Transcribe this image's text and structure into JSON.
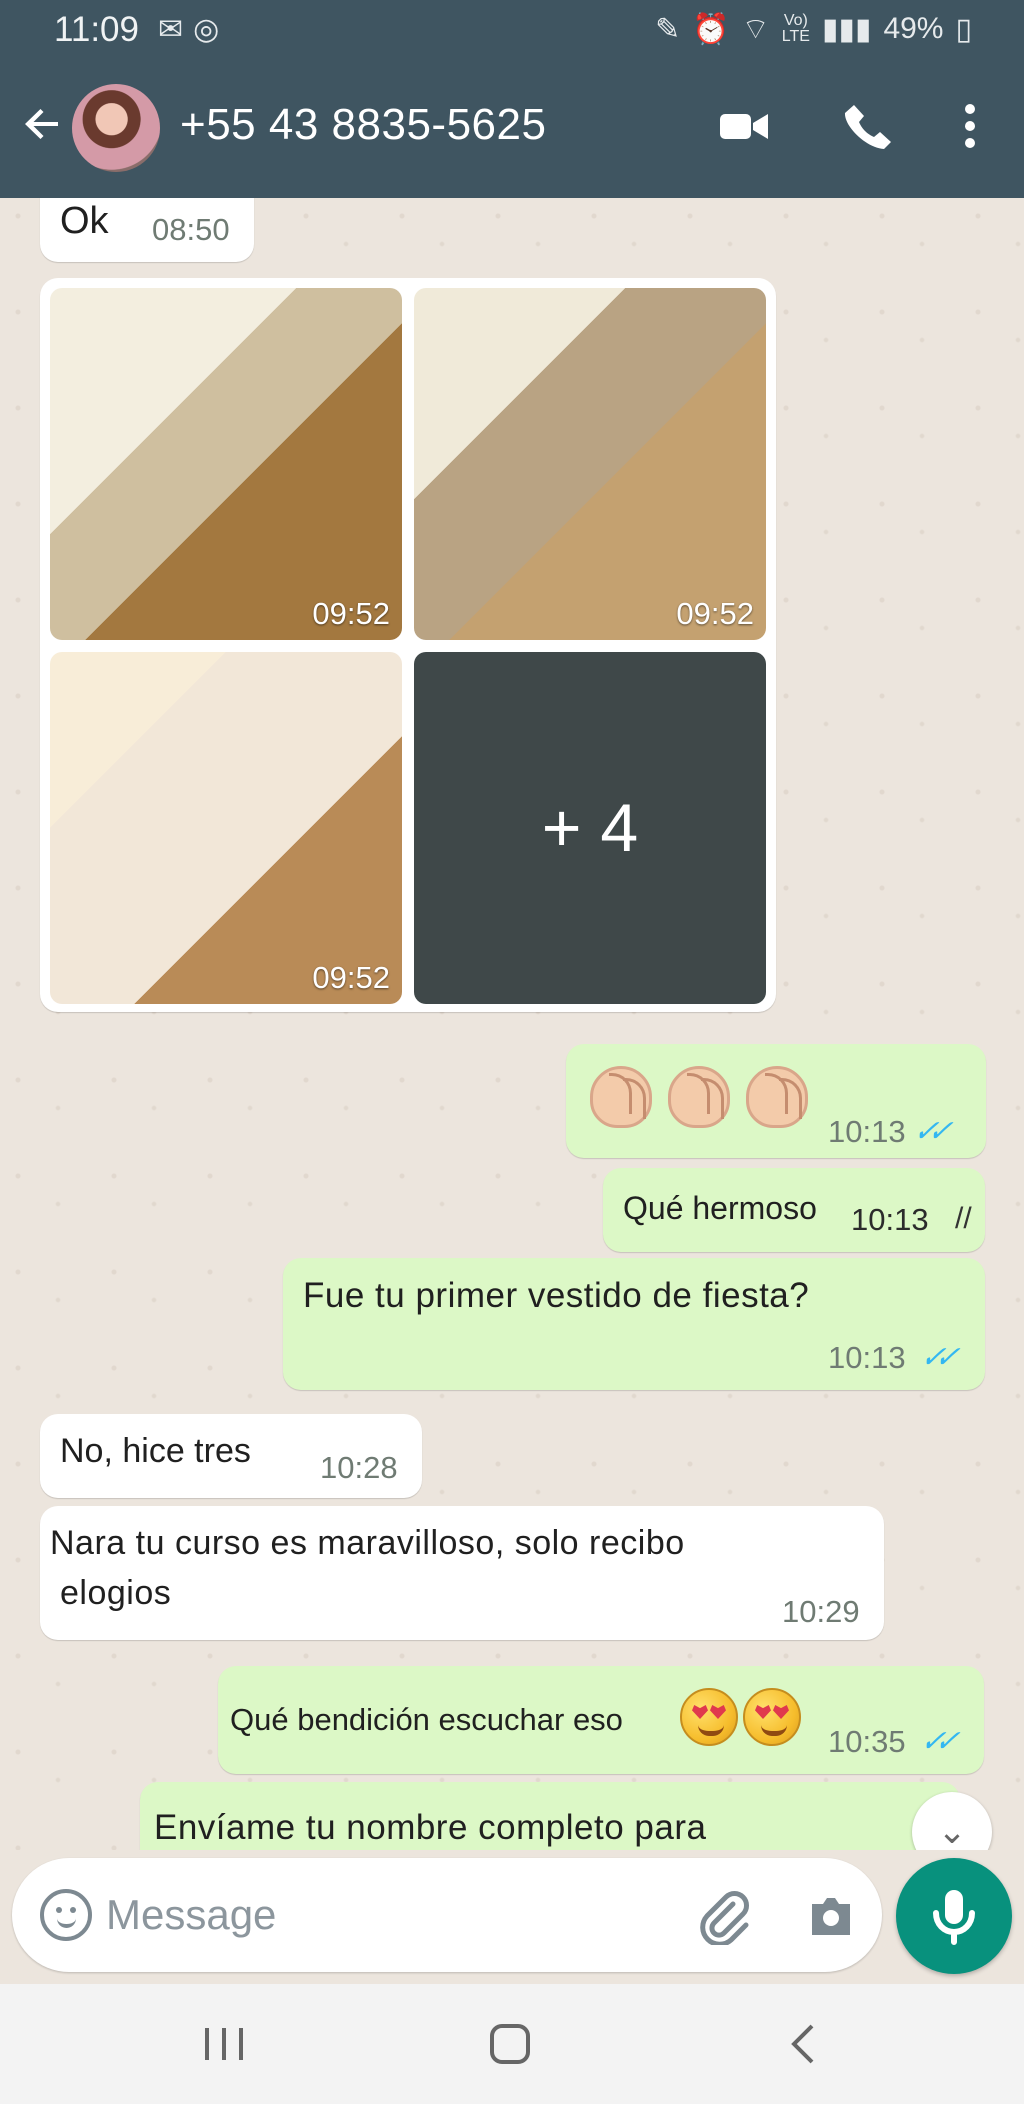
{
  "status_bar": {
    "time": "11:09",
    "battery": "49%"
  },
  "header": {
    "contact": "+55 43 8835-5625",
    "avatar": "contact-avatar"
  },
  "messages": [
    {
      "direction": "incoming",
      "text": "Ok",
      "time": "08:50"
    },
    {
      "direction": "incoming",
      "type": "image-grid",
      "tiles": [
        {
          "time": "09:52"
        },
        {
          "time": "09:52"
        },
        {
          "time": "09:52"
        },
        {
          "more_count": "+ 4"
        }
      ]
    },
    {
      "direction": "outgoing",
      "type": "emoji",
      "time": "10:13"
    },
    {
      "direction": "outgoing",
      "text": "Qué hermoso",
      "time": "10:13"
    },
    {
      "direction": "outgoing",
      "text": "Fue tu primer vestido de fiesta?",
      "time": "10:13"
    },
    {
      "direction": "incoming",
      "text": "No, hice tres",
      "time": "10:28"
    },
    {
      "direction": "incoming",
      "text_line_1": "Nara tu curso es maravilloso, solo recibo",
      "text_line_2": "elogios",
      "time": "10:29"
    },
    {
      "direction": "outgoing",
      "text": "Qué bendición escuchar eso",
      "time": "10:35"
    },
    {
      "direction": "outgoing",
      "text": "Envíame tu nombre completo para"
    }
  ],
  "composer": {
    "placeholder": "Message"
  },
  "colors": {
    "header": "#3f5561",
    "incoming_bubble": "#ffffff",
    "outgoing_bubble": "#dcf8c6",
    "accent": "#08917d",
    "read_ticks": "#34b7f1"
  }
}
